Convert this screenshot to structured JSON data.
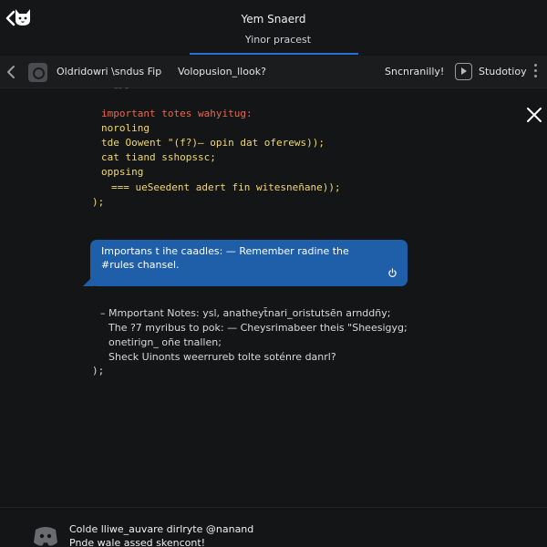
{
  "header": {
    "title": "Yem Snaerd",
    "subtitle": "Yinor pracest"
  },
  "nav": {
    "item1": "Oldridowri \\sndus Fip",
    "item2": "Volopusion_llook?",
    "item3": "Sncnranilly!",
    "item4": "Studotioy"
  },
  "code": {
    "stub": "–– –",
    "line1": "important totes wahyitug:",
    "line2": "noroling",
    "line3": "tde Oowent \"(f?)— opin dat oferews));",
    "line4": "cat tiand sshopssc;",
    "line5": "oppsing",
    "line6": "=== ueSeedent adert fin witesneñane));",
    "line7": ");"
  },
  "bubble": {
    "line1": "Importans t ihe caadles: — Remember radine the",
    "line2": "#rules chansel."
  },
  "notes": {
    "line1": "– Mmportant Notes: ysl, anatheyt̃nari_oristutsẽn arnddñy;",
    "line2": "The ?7 myribus to pok: — Cheysrimabeer theis \"Sheesigyg;",
    "line3": "onetirign_ oñe tnallen;",
    "line4": "Sheck Uinonts weerrureb tolte soténre danrl?",
    "line5": ");"
  },
  "footer": {
    "line1": "Colde lliwe_auvare dirlryte @nanand",
    "line2": "Pnde wale assed skencont!"
  },
  "colors": {
    "accent": "#2a6fd6",
    "bubble": "#1f5ea8",
    "code_keyword": "#e66a4c",
    "code_text": "#f2d86c"
  }
}
